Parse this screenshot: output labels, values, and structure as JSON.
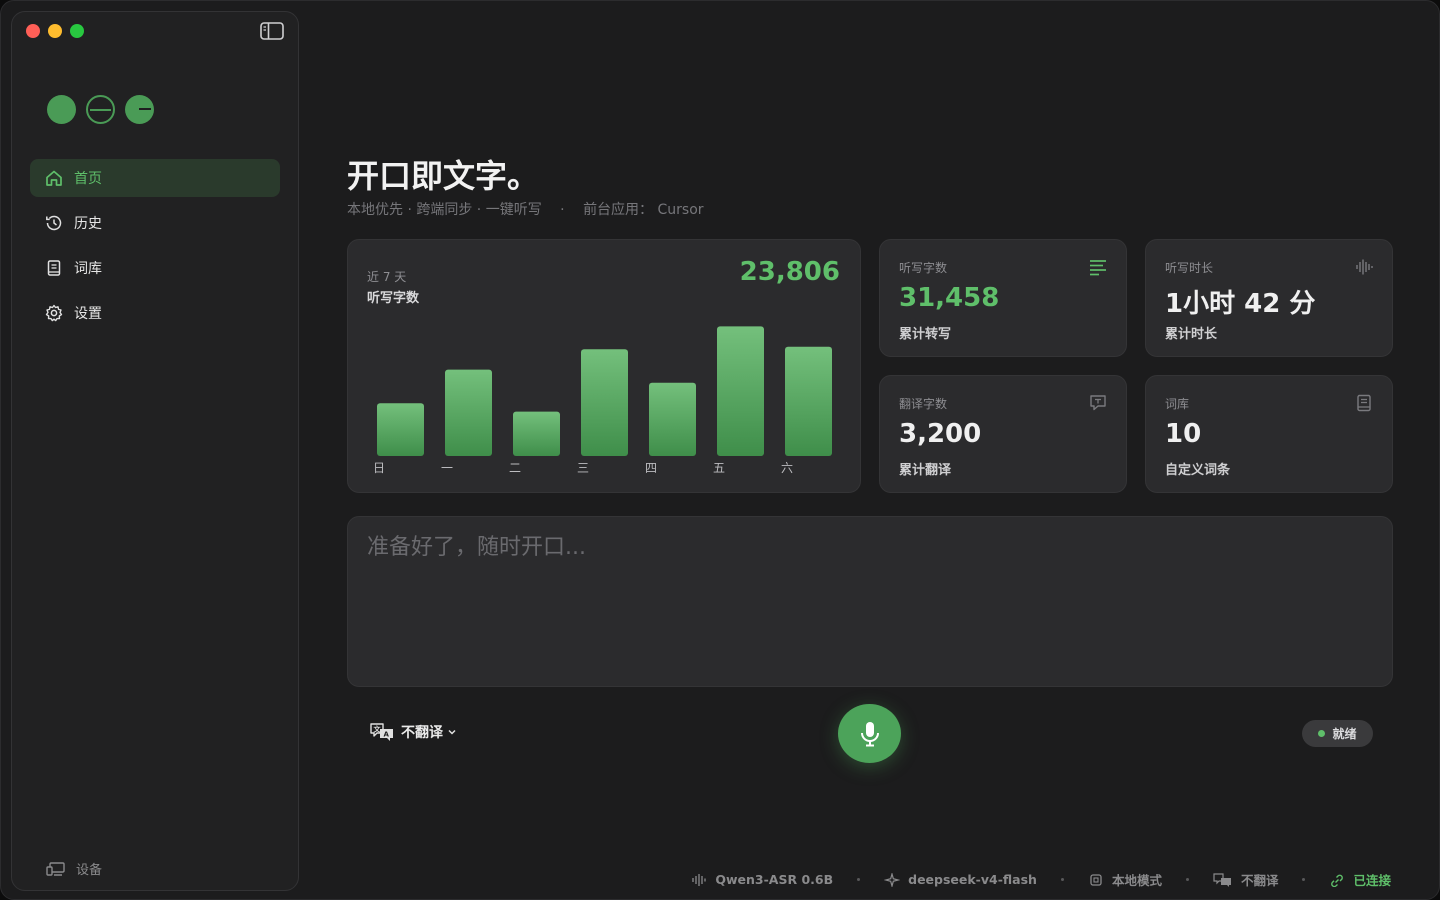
{
  "sidebar": {
    "items": [
      {
        "label": "首页",
        "icon": "home-icon",
        "active": true
      },
      {
        "label": "历史",
        "icon": "history-icon",
        "active": false
      },
      {
        "label": "词库",
        "icon": "dictionary-icon",
        "active": false
      },
      {
        "label": "设置",
        "icon": "gear-icon",
        "active": false
      }
    ],
    "footer_label": "设备"
  },
  "header": {
    "title": "开口即文字。",
    "tagline": "本地优先 · 跨端同步 · 一键听写",
    "foreground_app_label": "前台应用：",
    "foreground_app": "Cursor"
  },
  "chart_card": {
    "period": "近 7 天",
    "label": "听写字数",
    "total": "23,806"
  },
  "chart_data": {
    "type": "bar",
    "categories": [
      "日",
      "一",
      "二",
      "三",
      "四",
      "五",
      "六"
    ],
    "values": [
      2200,
      3600,
      1850,
      4450,
      3050,
      5400,
      4550
    ],
    "title": "",
    "xlabel": "",
    "ylabel": "",
    "ylim": [
      0,
      6000
    ],
    "grid": false,
    "colors": {
      "bar_top": "#74c07c",
      "bar_bottom": "#3f8e4a"
    }
  },
  "stats": [
    {
      "label": "听写字数",
      "value": "31,458",
      "caption": "累计转写",
      "icon": "lines-icon",
      "highlight": true
    },
    {
      "label": "听写时长",
      "value": "1小时 42 分",
      "caption": "累计时长",
      "icon": "waveform-icon",
      "highlight": false
    },
    {
      "label": "翻译字数",
      "value": "3,200",
      "caption": "累计翻译",
      "icon": "translate-bubble-icon",
      "highlight": false
    },
    {
      "label": "词库",
      "value": "10",
      "caption": "自定义词条",
      "icon": "book-icon",
      "highlight": false
    }
  ],
  "transcript": {
    "placeholder": "准备好了，随时开口..."
  },
  "controls": {
    "translate_label": "不翻译",
    "status": "就绪"
  },
  "statusbar": {
    "asr_model": "Qwen3-ASR 0.6B",
    "llm_model": "deepseek-v4-flash",
    "mode": "本地模式",
    "translate": "不翻译",
    "connection": "已连接"
  },
  "colors": {
    "accent": "#5fbf6a",
    "background": "#1c1c1d",
    "card": "#2b2b2d"
  }
}
